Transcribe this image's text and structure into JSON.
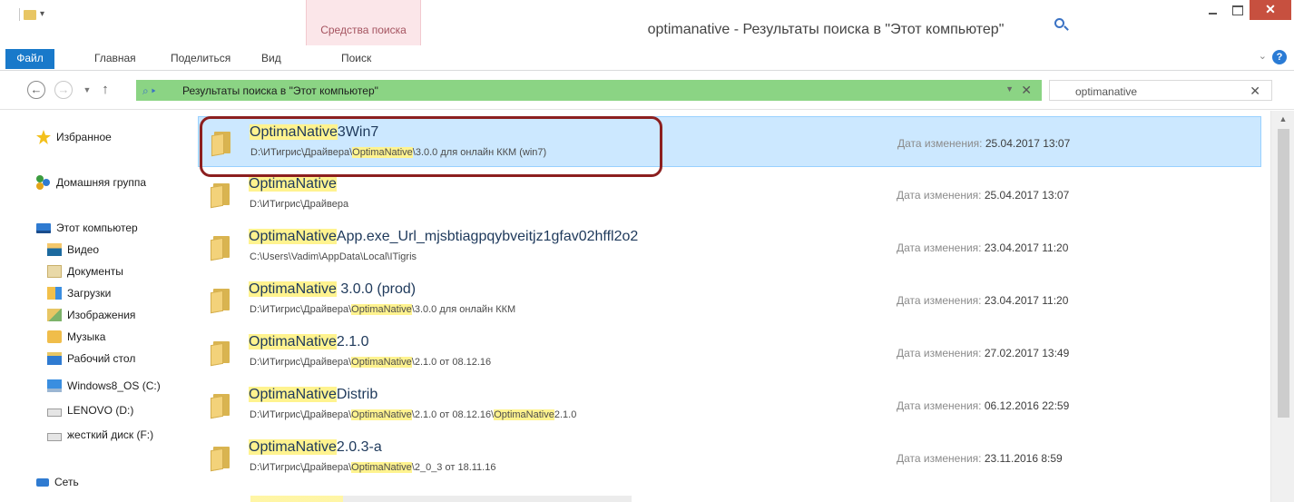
{
  "window": {
    "title": "optimanative - Результаты поиска в \"Этот компьютер\"",
    "context_tab": "Средства поиска",
    "close_glyph": "✕",
    "colors": {
      "file_tab": "#1979ca",
      "close_button": "#c7503f",
      "context_tab": "#fbe6e9",
      "address_highlight": "#8bd484",
      "selection": "#cce8ff",
      "match_highlight": "#fff38f",
      "annotation_border": "#8c1f1f"
    }
  },
  "ribbon": {
    "tabs": [
      "Файл",
      "Главная",
      "Поделиться",
      "Вид",
      "Поиск"
    ],
    "help_glyph": "?"
  },
  "address": {
    "back_glyph": "←",
    "forward_glyph": "→",
    "up_glyph": "↑",
    "breadcrumb": "Результаты поиска в \"Этот компьютер\"",
    "search_value": "optimanative",
    "clear_glyph": "✕"
  },
  "nav": {
    "favorites": "Избранное",
    "homegroup": "Домашняя группа",
    "this_pc": "Этот компьютер",
    "pc_items": [
      "Видео",
      "Документы",
      "Загрузки",
      "Изображения",
      "Музыка",
      "Рабочий стол",
      "Windows8_OS (C:)",
      "LENOVO (D:)",
      "жесткий диск (F:)"
    ],
    "network": "Сеть"
  },
  "results": {
    "date_label": "Дата изменения:",
    "items": [
      {
        "name_hl": "OptimaNative",
        "name_rest": "3Win7",
        "path_parts": [
          [
            "D:\\ИТигрис\\Драйвера\\",
            false
          ],
          [
            "OptimaNative",
            true
          ],
          [
            "\\3.0.0 для онлайн ККМ (win7)",
            false
          ]
        ],
        "date": "25.04.2017 13:07",
        "selected": true
      },
      {
        "name_hl": "OptimaNative",
        "name_rest": "",
        "path_parts": [
          [
            "D:\\ИТигрис\\Драйвера",
            false
          ]
        ],
        "date": "25.04.2017 13:07",
        "selected": false
      },
      {
        "name_hl": "OptimaNative",
        "name_rest": "App.exe_Url_mjsbtiagpqybveitjz1gfav02hffl2o2",
        "path_parts": [
          [
            "C:\\Users\\Vadim\\AppData\\Local\\ITigris",
            false
          ]
        ],
        "date": "23.04.2017 11:20",
        "selected": false
      },
      {
        "name_hl": "OptimaNative",
        "name_rest": " 3.0.0 (prod)",
        "path_parts": [
          [
            "D:\\ИТигрис\\Драйвера\\",
            false
          ],
          [
            "OptimaNative",
            true
          ],
          [
            "\\3.0.0 для онлайн ККМ",
            false
          ]
        ],
        "date": "23.04.2017 11:20",
        "selected": false
      },
      {
        "name_hl": "OptimaNative",
        "name_rest": "2.1.0",
        "path_parts": [
          [
            "D:\\ИТигрис\\Драйвера\\",
            false
          ],
          [
            "OptimaNative",
            true
          ],
          [
            "\\2.1.0 от 08.12.16",
            false
          ]
        ],
        "date": "27.02.2017 13:49",
        "selected": false
      },
      {
        "name_hl": "OptimaNative",
        "name_rest": "Distrib",
        "path_parts": [
          [
            "D:\\ИТигрис\\Драйвера\\",
            false
          ],
          [
            "OptimaNative",
            true
          ],
          [
            "\\2.1.0 от 08.12.16\\",
            false
          ],
          [
            "OptimaNative",
            true
          ],
          [
            "2.1.0",
            false
          ]
        ],
        "date": "06.12.2016 22:59",
        "selected": false
      },
      {
        "name_hl": "OptimaNative",
        "name_rest": "2.0.3-a",
        "path_parts": [
          [
            "D:\\ИТигрис\\Драйвера\\",
            false
          ],
          [
            "OptimaNative",
            true
          ],
          [
            "\\2_0_3 от 18.11.16",
            false
          ]
        ],
        "date": "23.11.2016 8:59",
        "selected": false
      }
    ]
  }
}
